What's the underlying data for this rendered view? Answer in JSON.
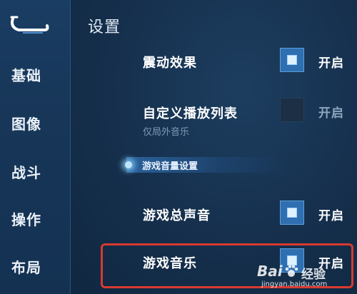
{
  "sidebar": {
    "items": [
      {
        "label": "基础"
      },
      {
        "label": "图像"
      },
      {
        "label": "战斗"
      },
      {
        "label": "操作"
      },
      {
        "label": "布局"
      }
    ]
  },
  "header": {
    "title": "设置"
  },
  "settings": {
    "vibration": {
      "label": "震动效果",
      "state": "开启",
      "checked": true
    },
    "custom_playlist": {
      "label": "自定义播放列表",
      "sub": "仅局外音乐",
      "state": "开启",
      "checked": false
    },
    "section_volume": {
      "label": "游戏音量设置"
    },
    "master_sound": {
      "label": "游戏总声音",
      "state": "开启",
      "checked": true
    },
    "game_music": {
      "label": "游戏音乐",
      "state": "开启",
      "checked": true
    }
  },
  "watermark": {
    "brand_left": "Bai",
    "brand_right": "经验",
    "site": "jingyan.baidu.com"
  },
  "colors": {
    "accent": "#2f6fb0",
    "highlight_border": "#d93a30",
    "sidebar_bg": "#173658"
  }
}
